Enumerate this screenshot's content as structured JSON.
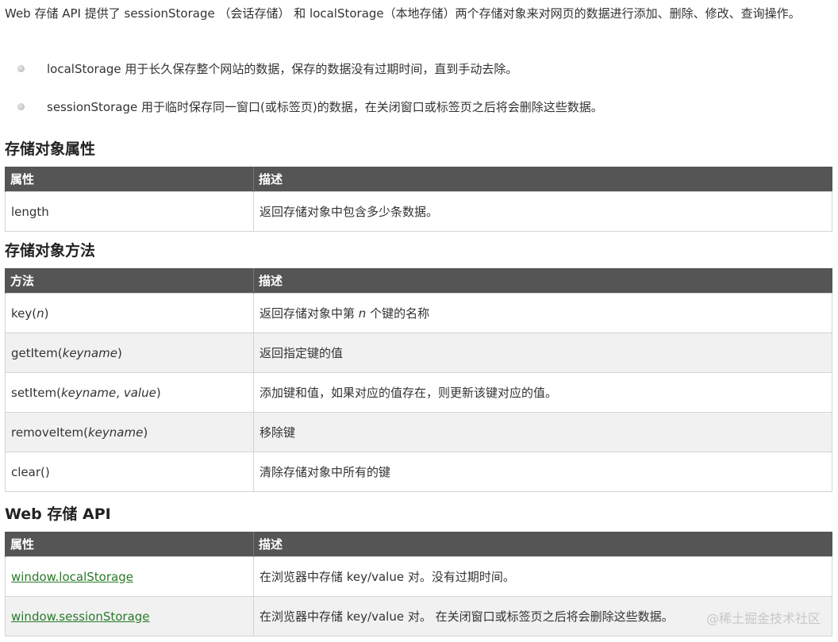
{
  "intro": {
    "text": "Web 存储 API 提供了 sessionStorage （会话存储） 和 localStorage（本地存储）两个存储对象来对网页的数据进行添加、删除、修改、查询操作。"
  },
  "bullets": [
    {
      "text": "localStorage 用于长久保存整个网站的数据，保存的数据没有过期时间，直到手动去除。"
    },
    {
      "text": "sessionStorage 用于临时保存同一窗口(或标签页)的数据，在关闭窗口或标签页之后将会删除这些数据。"
    }
  ],
  "section_properties": {
    "heading": "存储对象属性",
    "headers": [
      "属性",
      "描述"
    ],
    "rows": [
      {
        "name": "length",
        "desc": "返回存储对象中包含多少条数据。"
      }
    ]
  },
  "section_methods": {
    "heading": "存储对象方法",
    "headers": [
      "方法",
      "描述"
    ],
    "rows": [
      {
        "name_prefix": "key(",
        "name_arg": "n",
        "name_suffix": ")",
        "desc_prefix": "返回存储对象中第 ",
        "desc_arg": "n",
        "desc_suffix": " 个键的名称"
      },
      {
        "name_prefix": "getItem(",
        "name_arg": "keyname",
        "name_suffix": ")",
        "desc": "返回指定键的值"
      },
      {
        "name_prefix": "setItem(",
        "name_arg": "keyname",
        "name_sep": ", ",
        "name_arg2": "value",
        "name_suffix": ")",
        "desc": "添加键和值，如果对应的值存在，则更新该键对应的值。"
      },
      {
        "name_prefix": "removeItem(",
        "name_arg": "keyname",
        "name_suffix": ")",
        "desc": "移除键"
      },
      {
        "name": "clear()",
        "desc": "清除存储对象中所有的键"
      }
    ]
  },
  "section_api": {
    "heading": "Web 存储 API",
    "headers": [
      "属性",
      "描述"
    ],
    "rows": [
      {
        "name": "window.localStorage",
        "desc": "在浏览器中存储 key/value 对。没有过期时间。"
      },
      {
        "name": "window.sessionStorage",
        "desc": "在浏览器中存储 key/value 对。 在关闭窗口或标签页之后将会删除这些数据。"
      }
    ]
  },
  "watermark": "@稀土掘金技术社区",
  "colors": {
    "header_bg": "#555555",
    "link": "#2a7a2a",
    "alt_row": "#f1f1f1"
  }
}
